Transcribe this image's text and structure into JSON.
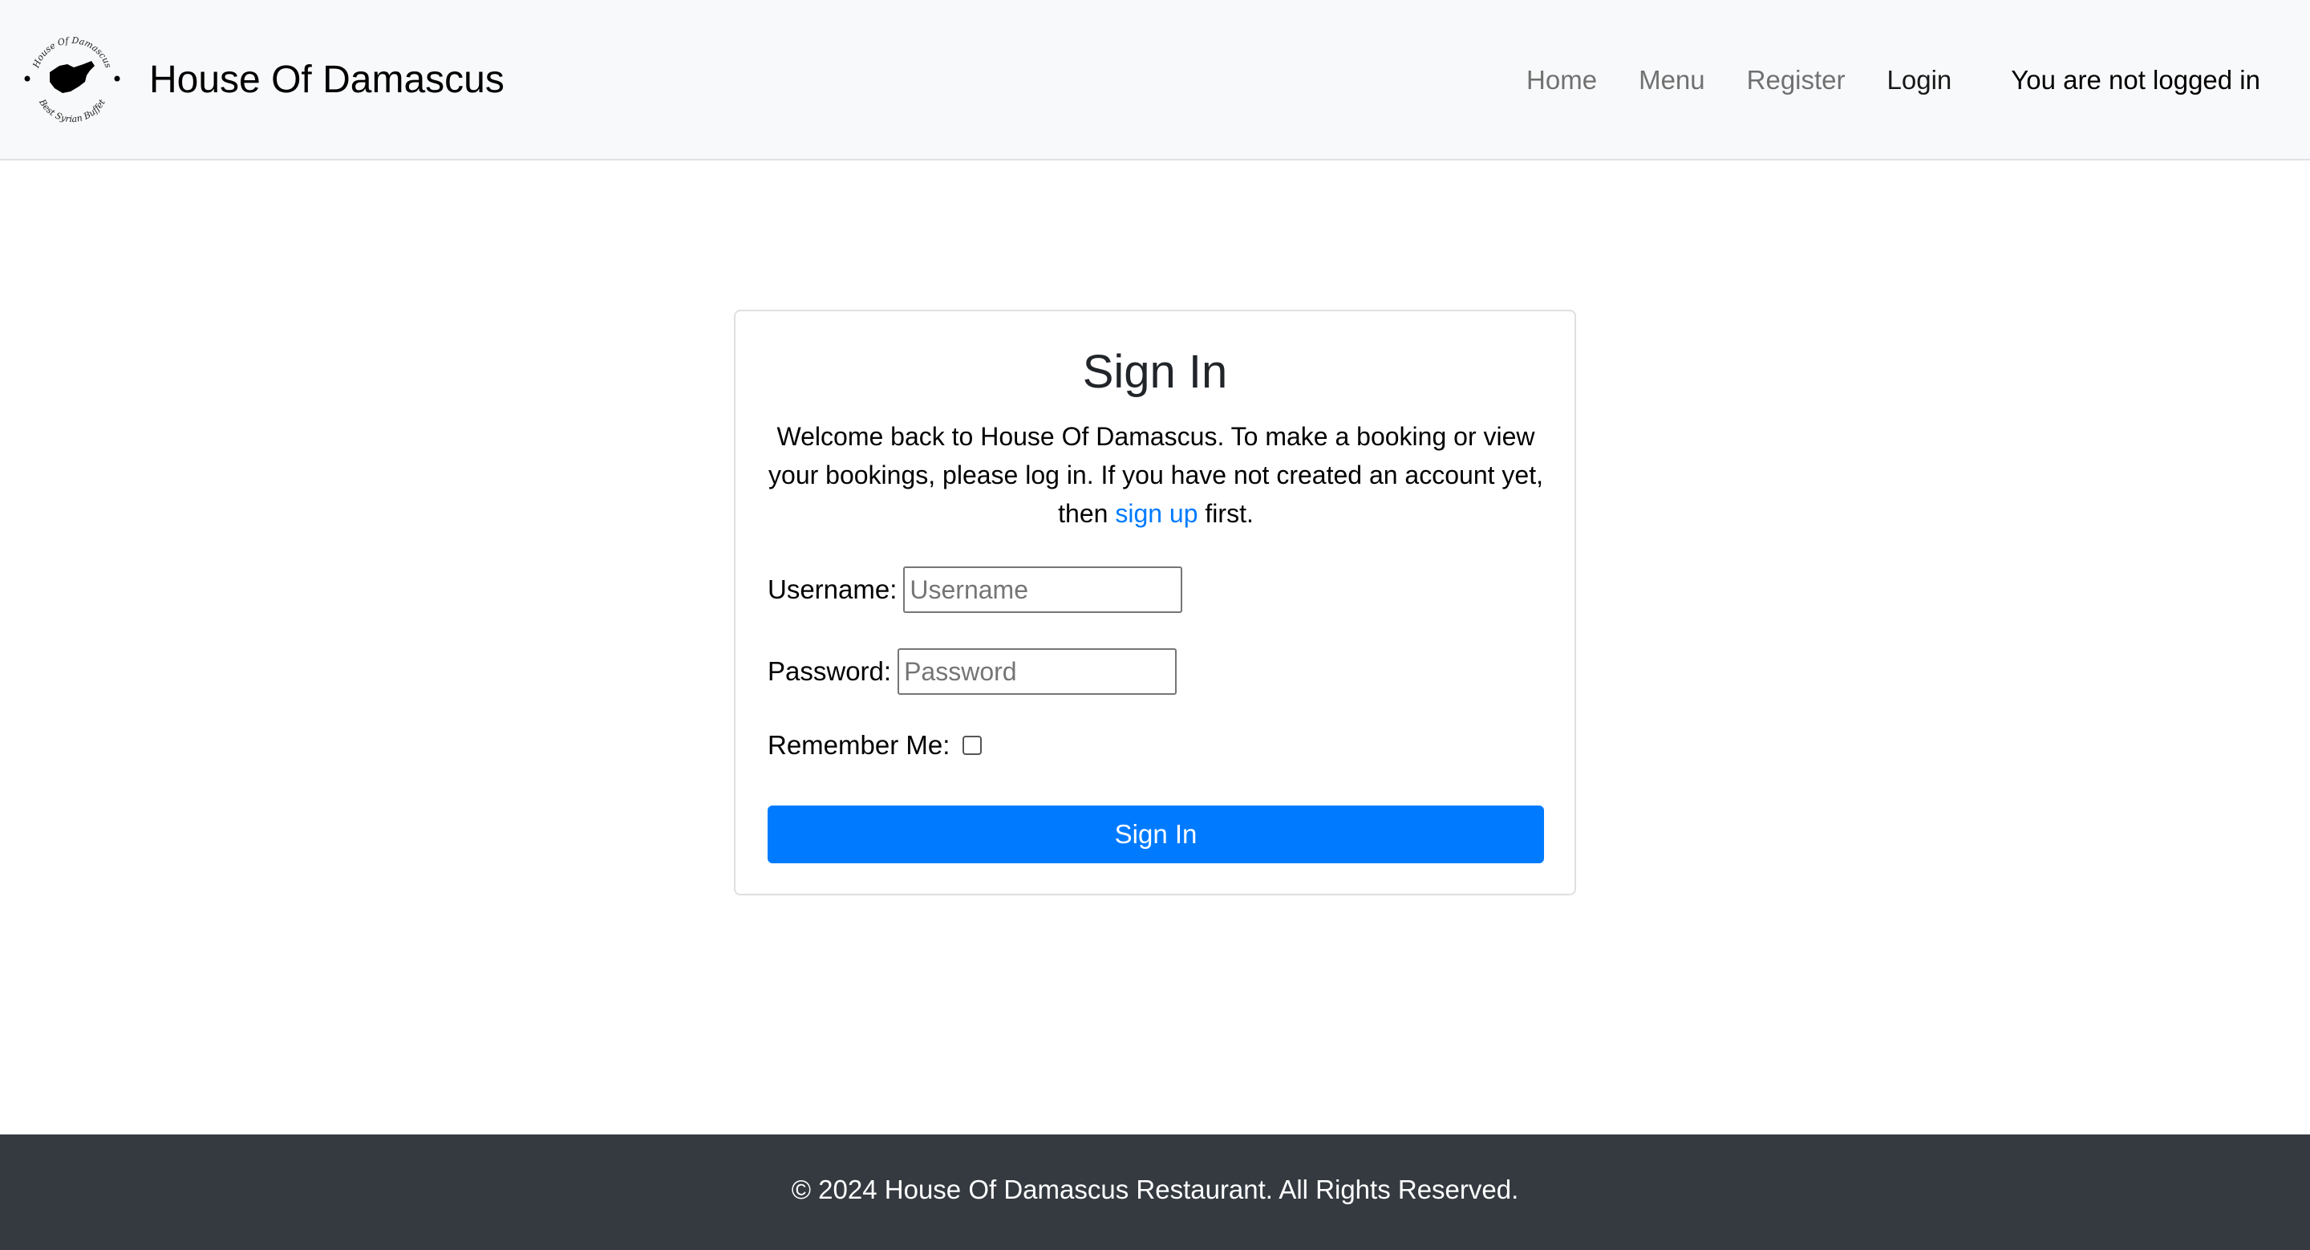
{
  "navbar": {
    "brand": "House Of Damascus",
    "logo_text_top": "House Of Damascus",
    "logo_text_bottom": "Best Syrian Buffet",
    "links": [
      {
        "label": "Home",
        "active": false
      },
      {
        "label": "Menu",
        "active": false
      },
      {
        "label": "Register",
        "active": false
      },
      {
        "label": "Login",
        "active": true
      }
    ],
    "status": "You are not logged in"
  },
  "signin": {
    "title": "Sign In",
    "intro_before": "Welcome back to House Of Damascus. To make a booking or view your bookings, please log in. If you have not created an account yet, then",
    "signup_link": "sign up",
    "intro_after": "first.",
    "username_label": "Username:",
    "username_placeholder": "Username",
    "username_value": "",
    "password_label": "Password:",
    "password_placeholder": "Password",
    "password_value": "",
    "remember_label": "Remember Me:",
    "remember_checked": false,
    "submit_label": "Sign In"
  },
  "footer": {
    "text": "© 2024 House Of Damascus Restaurant. All Rights Reserved."
  },
  "colors": {
    "navbar_bg": "#f8f9fa",
    "primary": "#007bff",
    "footer_bg": "#343a40"
  },
  "icons": {
    "logo": "syria-map-logo"
  }
}
